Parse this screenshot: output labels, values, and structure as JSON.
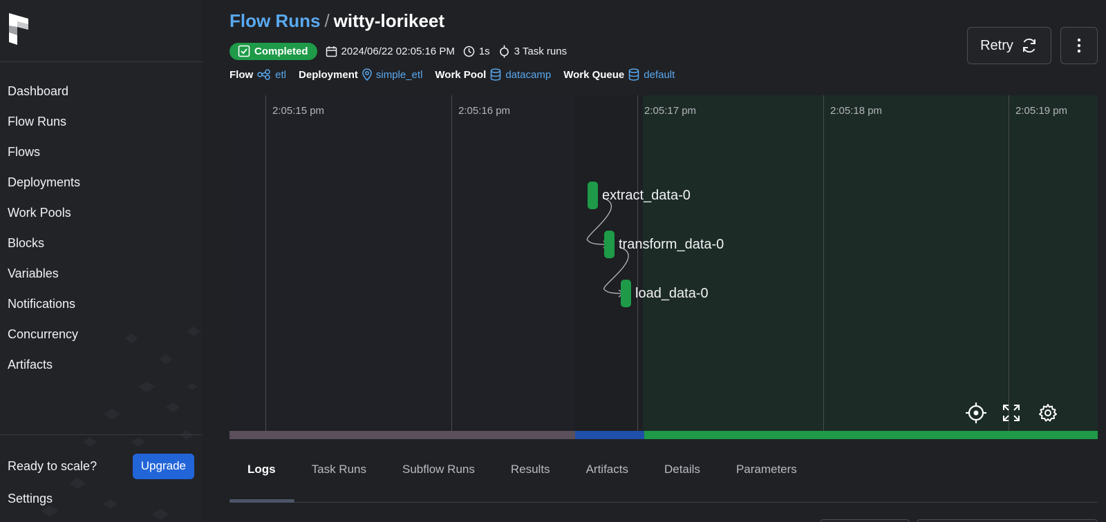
{
  "sidebar": {
    "nav": [
      "Dashboard",
      "Flow Runs",
      "Flows",
      "Deployments",
      "Work Pools",
      "Blocks",
      "Variables",
      "Notifications",
      "Concurrency",
      "Artifacts"
    ],
    "scale_text": "Ready to scale?",
    "upgrade_label": "Upgrade",
    "settings_label": "Settings"
  },
  "header": {
    "breadcrumb_parent": "Flow Runs",
    "breadcrumb_sep": "/",
    "breadcrumb_current": "witty-lorikeet",
    "status": "Completed",
    "start_time": "2024/06/22 02:05:16 PM",
    "duration": "1s",
    "task_runs": "3 Task runs",
    "flow_label": "Flow",
    "flow_value": "etl",
    "deployment_label": "Deployment",
    "deployment_value": "simple_etl",
    "work_pool_label": "Work Pool",
    "work_pool_value": "datacamp",
    "work_queue_label": "Work Queue",
    "work_queue_value": "default",
    "retry_label": "Retry"
  },
  "timeline": {
    "ticks": [
      "2:05:15 pm",
      "2:05:16 pm",
      "2:05:17 pm",
      "2:05:18 pm",
      "2:05:19 pm"
    ],
    "tasks": [
      "extract_data-0",
      "transform_data-0",
      "load_data-0"
    ]
  },
  "tabs": [
    "Logs",
    "Task Runs",
    "Subflow Runs",
    "Results",
    "Artifacts",
    "Details",
    "Parameters"
  ],
  "colors": {
    "accent_link": "#59a9f0",
    "success": "#1e9a48",
    "upgrade": "#2265d8",
    "state_pending": "#5a4f5a",
    "state_running": "#1f4fa8"
  },
  "icons": {
    "logo": "prefect-logo-icon",
    "badge": "check-square-icon",
    "date": "calendar-icon",
    "duration": "clock-icon",
    "task_runs": "task-node-icon",
    "flow": "flow-icon",
    "deployment": "location-pin-icon",
    "work_pool": "database-icon",
    "work_queue": "database-icon",
    "retry": "refresh-icon",
    "more": "vertical-dots-icon",
    "recenter": "crosshair-icon",
    "fullscreen": "expand-icon",
    "settings": "gear-icon"
  }
}
